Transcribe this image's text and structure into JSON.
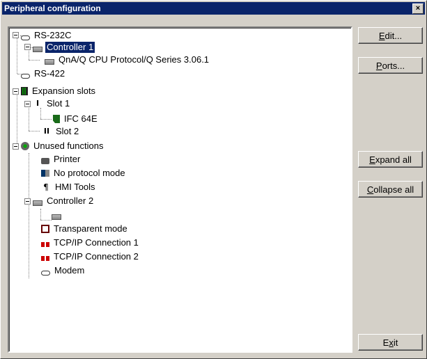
{
  "window": {
    "title": "Peripheral configuration",
    "close_glyph": "×"
  },
  "tree": {
    "nodes": [
      {
        "label": "RS-232C",
        "icon": "serial-port-icon"
      },
      {
        "label": "Controller 1",
        "icon": "controller-icon",
        "selected": true
      },
      {
        "label": "QnA/Q CPU Protocol/Q Series 3.06.1",
        "icon": "controller-icon"
      },
      {
        "label": "RS-422",
        "icon": "serial-port-icon"
      },
      {
        "label": "Expansion slots",
        "icon": "expansion-slots-icon"
      },
      {
        "label": "Slot 1",
        "icon": "slot-icon"
      },
      {
        "label": "IFC 64E",
        "icon": "expansion-card-icon"
      },
      {
        "label": "Slot 2",
        "icon": "slot-icon"
      },
      {
        "label": "Unused functions",
        "icon": "unused-functions-icon"
      },
      {
        "label": "Printer",
        "icon": "printer-icon"
      },
      {
        "label": "No protocol mode",
        "icon": "no-protocol-icon"
      },
      {
        "label": "HMI Tools",
        "icon": "hmi-tools-icon"
      },
      {
        "label": "Controller 2",
        "icon": "controller-icon"
      },
      {
        "label": "",
        "icon": "controller-icon"
      },
      {
        "label": "Transparent mode",
        "icon": "transparent-mode-icon"
      },
      {
        "label": "TCP/IP Connection 1",
        "icon": "network-connection-icon"
      },
      {
        "label": "TCP/IP Connection 2",
        "icon": "network-connection-icon"
      },
      {
        "label": "Modem",
        "icon": "modem-icon"
      }
    ]
  },
  "buttons": {
    "edit": {
      "mnemonic": "E",
      "rest": "dit..."
    },
    "ports": {
      "mnemonic": "P",
      "rest": "orts..."
    },
    "expand_all": {
      "mnemonic": "E",
      "rest": "xpand all"
    },
    "collapse_all": {
      "mnemonic": "C",
      "rest": "ollapse all"
    },
    "exit": {
      "pre": "E",
      "mnemonic": "x",
      "rest": "it"
    }
  }
}
